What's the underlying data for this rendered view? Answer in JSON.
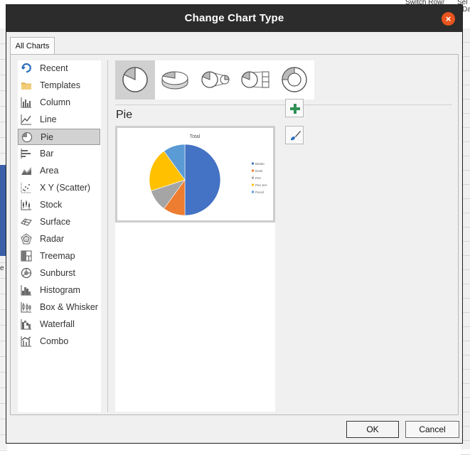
{
  "background": {
    "top_right_text_1": "Switch Row/",
    "top_right_text_2": "Sel",
    "top_right_text_3": "Da",
    "left_edge_text": "e"
  },
  "dialog": {
    "title": "Change Chart Type",
    "close_icon": "×",
    "tab_label": "All Charts",
    "section_title": "Pie",
    "ok_label": "OK",
    "cancel_label": "Cancel"
  },
  "chart_types": [
    {
      "label": "Recent",
      "icon": "recent-icon"
    },
    {
      "label": "Templates",
      "icon": "folder-icon"
    },
    {
      "label": "Column",
      "icon": "column-chart-icon"
    },
    {
      "label": "Line",
      "icon": "line-chart-icon"
    },
    {
      "label": "Pie",
      "icon": "pie-chart-icon",
      "selected": true
    },
    {
      "label": "Bar",
      "icon": "bar-chart-icon"
    },
    {
      "label": "Area",
      "icon": "area-chart-icon"
    },
    {
      "label": "X Y (Scatter)",
      "icon": "scatter-chart-icon"
    },
    {
      "label": "Stock",
      "icon": "stock-chart-icon"
    },
    {
      "label": "Surface",
      "icon": "surface-chart-icon"
    },
    {
      "label": "Radar",
      "icon": "radar-chart-icon"
    },
    {
      "label": "Treemap",
      "icon": "treemap-chart-icon"
    },
    {
      "label": "Sunburst",
      "icon": "sunburst-chart-icon"
    },
    {
      "label": "Histogram",
      "icon": "histogram-chart-icon"
    },
    {
      "label": "Box & Whisker",
      "icon": "box-whisker-chart-icon"
    },
    {
      "label": "Waterfall",
      "icon": "waterfall-chart-icon"
    },
    {
      "label": "Combo",
      "icon": "combo-chart-icon"
    }
  ],
  "pie_subtypes": [
    {
      "icon": "pie-icon",
      "selected": true
    },
    {
      "icon": "3d-pie-icon"
    },
    {
      "icon": "pie-of-pie-icon"
    },
    {
      "icon": "bar-of-pie-icon"
    },
    {
      "icon": "doughnut-icon"
    }
  ],
  "side_buttons": [
    {
      "icon": "add-element-icon"
    },
    {
      "icon": "style-brush-icon"
    }
  ],
  "colors": {
    "title_bar": "#2c2c2c",
    "close_button": "#e9541e",
    "selection": "#d2d2d2",
    "icon_blue": "#2e6fba"
  },
  "chart_data": {
    "type": "pie",
    "title": "Total",
    "categories": [
      "Binder",
      "Desk",
      "Pen",
      "Pen Set",
      "Pencil"
    ],
    "values": [
      50,
      10,
      10,
      20,
      10
    ],
    "colors": [
      "#4472c4",
      "#ed7d31",
      "#a5a5a5",
      "#ffc000",
      "#5b9bd5"
    ],
    "legend_position": "right"
  }
}
